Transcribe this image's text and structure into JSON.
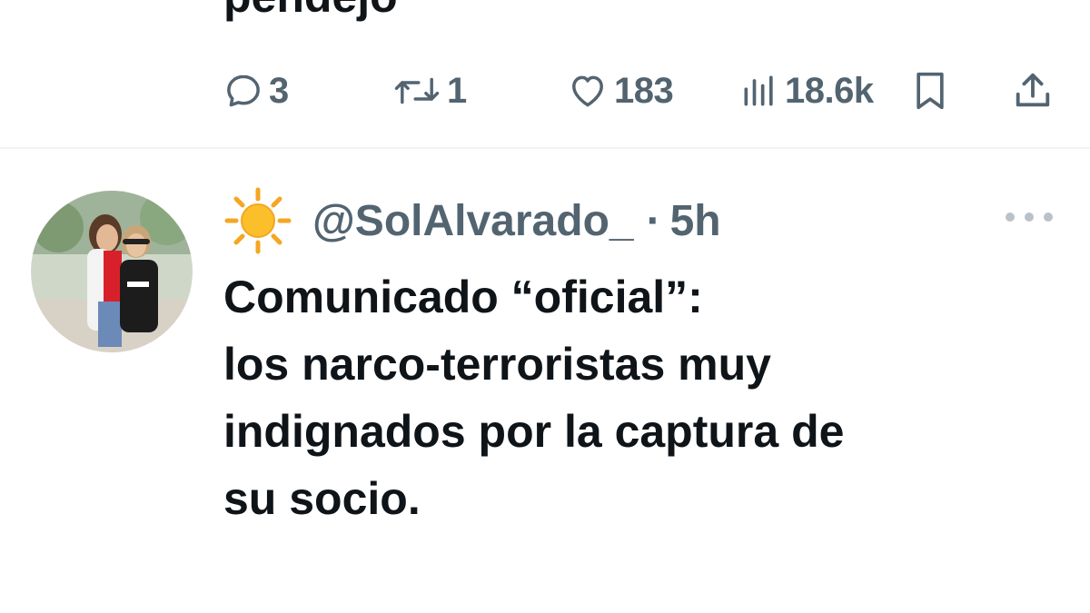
{
  "previous_tweet": {
    "text_fragment": "pendejo",
    "actions": {
      "replies": "3",
      "retweets": "1",
      "likes": "183",
      "views": "18.6k"
    }
  },
  "icons": {
    "reply": "reply-icon",
    "retweet": "retweet-icon",
    "like": "heart-icon",
    "views": "views-chart-icon",
    "bookmark": "bookmark-icon",
    "share": "share-icon",
    "more": "more-options-icon",
    "emoji": "sun-emoji-icon"
  },
  "tweet": {
    "handle": "@SolAlvarado_",
    "separator": "·",
    "time": "5h",
    "text": "Comunicado “oficial”:\nlos narco-terroristas muy\nindignados por la captura de\nsu socio."
  },
  "colors": {
    "text_primary": "#0f1419",
    "text_secondary": "#536471",
    "divider": "#eff3f4",
    "background": "#ffffff"
  }
}
